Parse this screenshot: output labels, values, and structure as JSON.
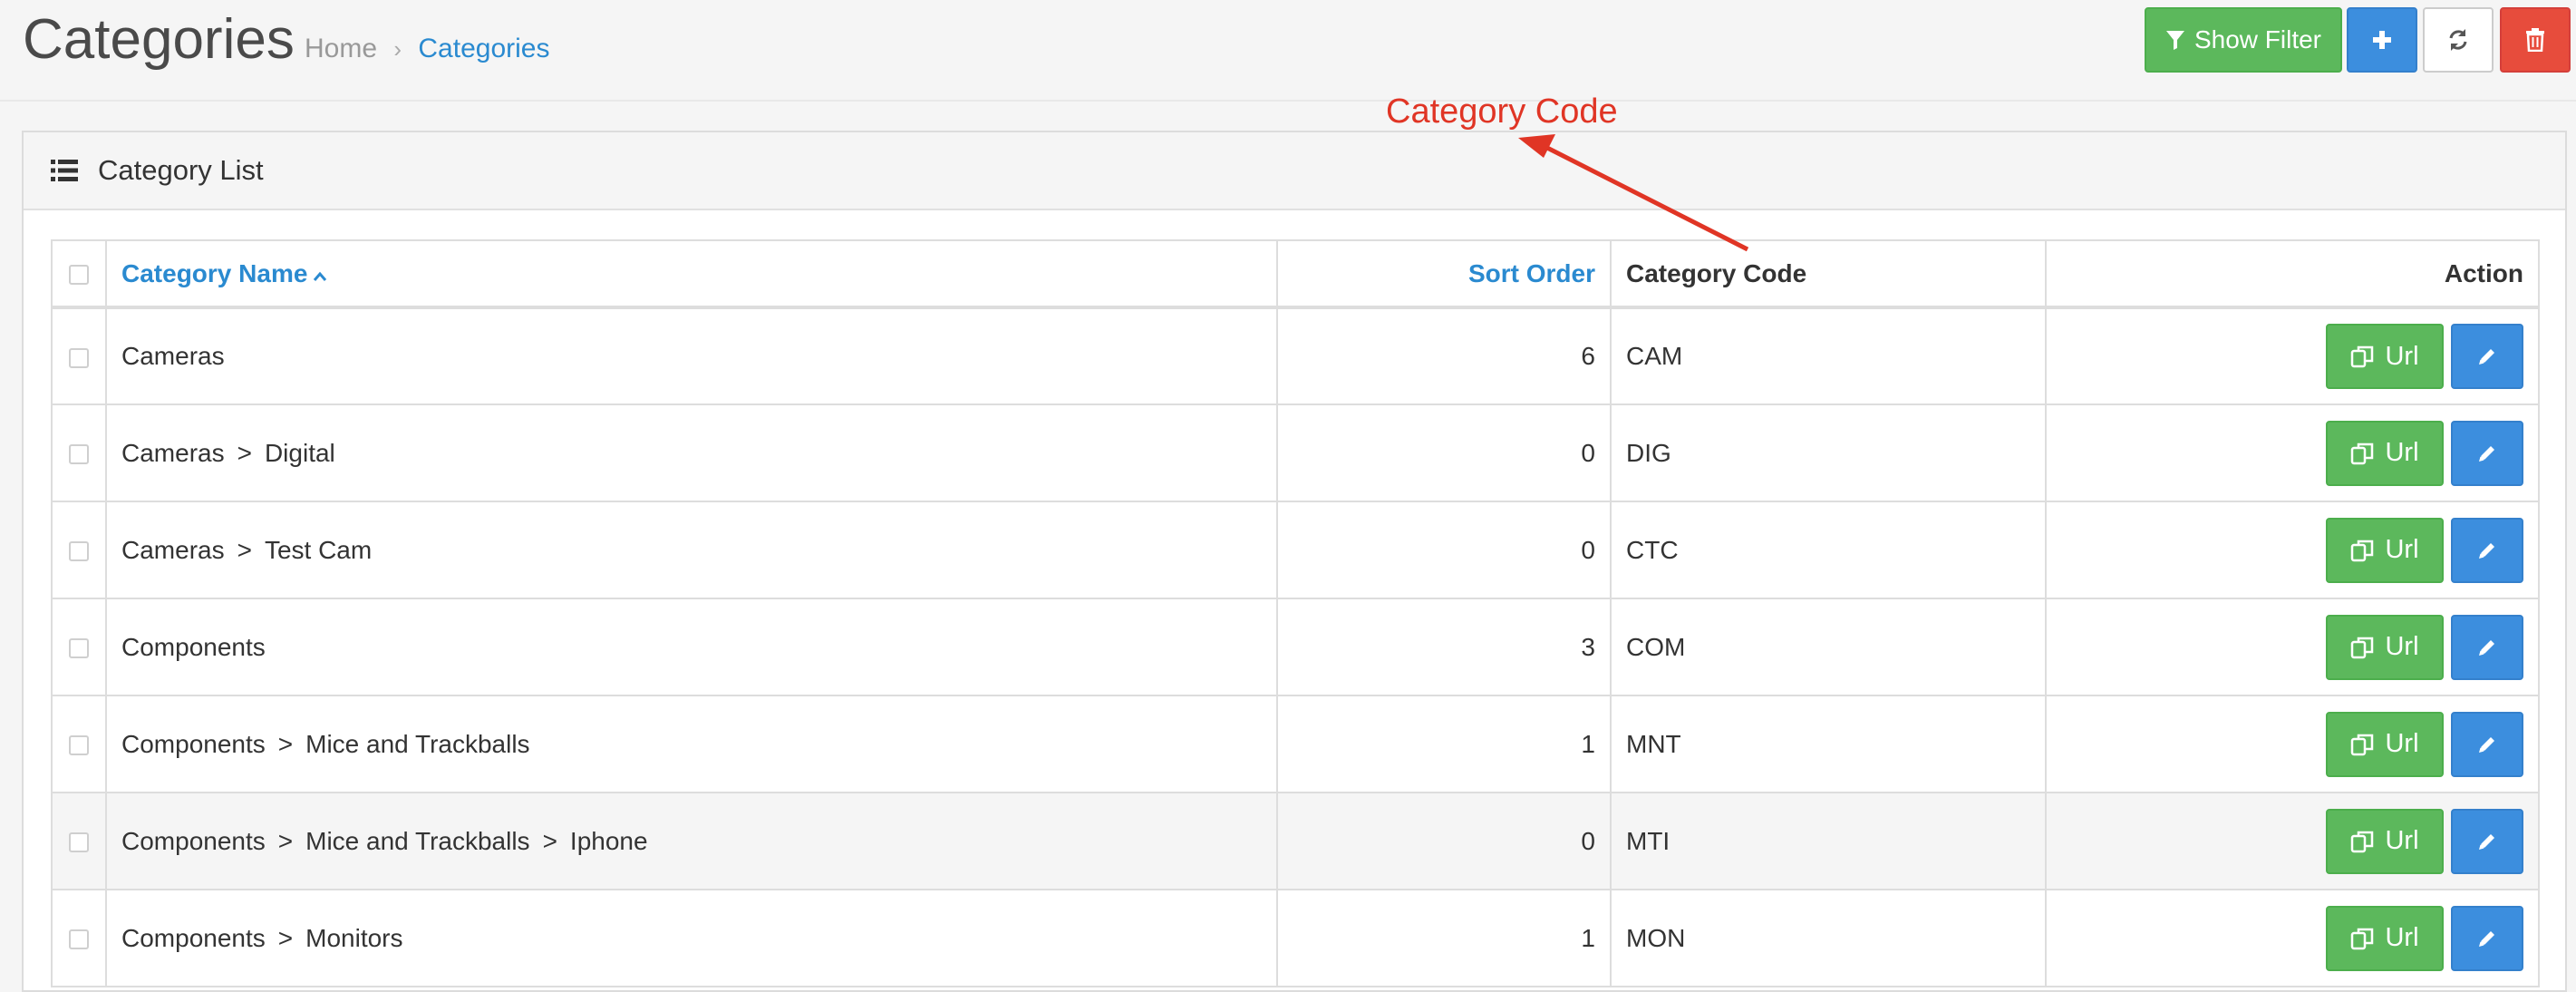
{
  "header": {
    "title": "Categories",
    "breadcrumb": [
      {
        "label": "Home"
      },
      {
        "label": "Categories"
      }
    ],
    "breadcrumb_separator": "›",
    "buttons": {
      "show_filter": "Show Filter",
      "add_icon": "plus-icon",
      "refresh_icon": "refresh-icon",
      "delete_icon": "trash-icon"
    }
  },
  "annotation": {
    "text": "Category Code",
    "color": "#e03525"
  },
  "panel": {
    "title": "Category List",
    "icon": "list-icon"
  },
  "table": {
    "columns": {
      "name": "Category Name",
      "sort_order": "Sort Order",
      "code": "Category Code",
      "action": "Action"
    },
    "path_separator": ">",
    "url_button_label": "Url",
    "rows": [
      {
        "path": [
          "Cameras"
        ],
        "sort_order": "6",
        "code": "CAM"
      },
      {
        "path": [
          "Cameras",
          "Digital"
        ],
        "sort_order": "0",
        "code": "DIG"
      },
      {
        "path": [
          "Cameras",
          "Test Cam"
        ],
        "sort_order": "0",
        "code": "CTC"
      },
      {
        "path": [
          "Components"
        ],
        "sort_order": "3",
        "code": "COM"
      },
      {
        "path": [
          "Components",
          "Mice and Trackballs"
        ],
        "sort_order": "1",
        "code": "MNT"
      },
      {
        "path": [
          "Components",
          "Mice and Trackballs",
          "Iphone"
        ],
        "sort_order": "0",
        "code": "MTI"
      },
      {
        "path": [
          "Components",
          "Monitors"
        ],
        "sort_order": "1",
        "code": "MON"
      }
    ]
  },
  "colors": {
    "success": "#5cb85c",
    "primary": "#3c8ede",
    "danger": "#e74c3c",
    "link": "#2a8ad0"
  }
}
